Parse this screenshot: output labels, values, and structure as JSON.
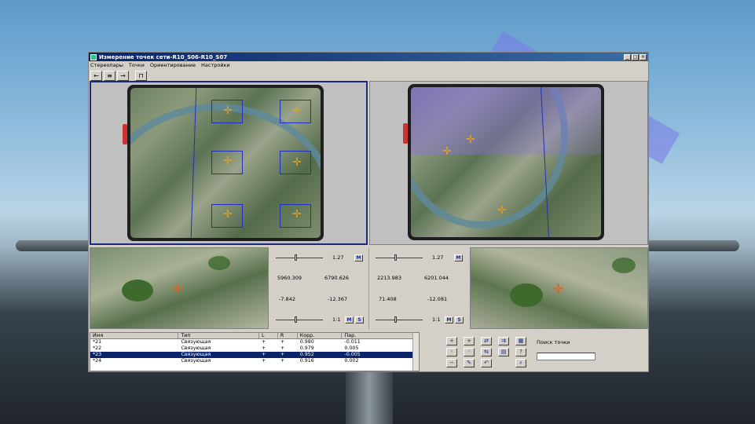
{
  "window": {
    "title": "Измерение точек сети-R10_S06-R10_S07",
    "controls": [
      "_",
      "□",
      "×"
    ]
  },
  "menu": [
    "Стереопары",
    "Точки",
    "Ориентирование",
    "Настройки"
  ],
  "toolbar": {
    "back_label": "←",
    "list_label": "≡",
    "next_label": "→",
    "measure_label": "⊓"
  },
  "left_controls": {
    "zoom_value": "1.27",
    "m_label": "M",
    "x": "5960.309",
    "y": "6790.626",
    "dx": "-7.842",
    "dy": "-12.367",
    "scale": "1:1",
    "s_label": "S"
  },
  "right_controls": {
    "zoom_value": "1.27",
    "m_label": "M",
    "x": "2213.983",
    "y": "6201.044",
    "dx": "71.408",
    "dy": "-12.081",
    "scale": "1:1",
    "s_label": "S"
  },
  "table": {
    "headers": [
      "Имя",
      "Тип",
      "L",
      "R",
      "Корр.",
      "Пар."
    ],
    "rows": [
      {
        "name": "*21",
        "type": "Связующая",
        "l": "+",
        "r": "+",
        "corr": "0.980",
        "par": "-0.011",
        "selected": false
      },
      {
        "name": "*22",
        "type": "Связующая",
        "l": "+",
        "r": "+",
        "corr": "0.979",
        "par": "0.005",
        "selected": false
      },
      {
        "name": "*23",
        "type": "Связующая",
        "l": "+",
        "r": "+",
        "corr": "0.952",
        "par": "-0.005",
        "selected": true
      },
      {
        "name": "*24",
        "type": "Связующая",
        "l": "+",
        "r": "+",
        "corr": "0.916",
        "par": "0.002",
        "selected": false
      }
    ]
  },
  "search": {
    "label": "Поиск точки",
    "value": ""
  },
  "colors": {
    "title_bar": "#0a246a",
    "selection": "#0a246a",
    "overlay_lines": "#2030c0",
    "point_marker": "#e0a020"
  }
}
